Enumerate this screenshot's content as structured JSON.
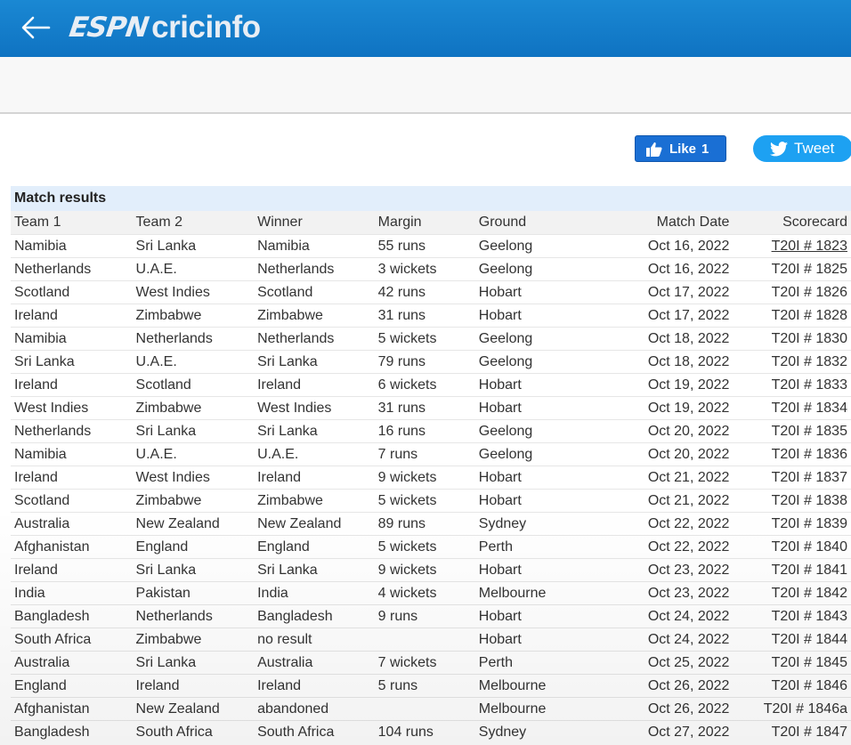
{
  "header": {
    "back_icon": "arrow-left-icon",
    "logo_espn": "ESPN",
    "logo_cricinfo": "cricinfo",
    "bg_color": "#1480cb"
  },
  "social": {
    "like_label": "Like",
    "like_count": "1",
    "tweet_label": "Tweet",
    "like_icon": "thumbs-up-icon",
    "tweet_icon": "twitter-bird-icon"
  },
  "table": {
    "title": "Match results",
    "headers": [
      "Team 1",
      "Team 2",
      "Winner",
      "Margin",
      "Ground",
      "Match Date",
      "Scorecard"
    ],
    "rows": [
      [
        "Namibia",
        "Sri Lanka",
        "Namibia",
        "55 runs",
        "Geelong",
        "Oct 16, 2022",
        "T20I # 1823"
      ],
      [
        "Netherlands",
        "U.A.E.",
        "Netherlands",
        "3 wickets",
        "Geelong",
        "Oct 16, 2022",
        "T20I # 1825"
      ],
      [
        "Scotland",
        "West Indies",
        "Scotland",
        "42 runs",
        "Hobart",
        "Oct 17, 2022",
        "T20I # 1826"
      ],
      [
        "Ireland",
        "Zimbabwe",
        "Zimbabwe",
        "31 runs",
        "Hobart",
        "Oct 17, 2022",
        "T20I # 1828"
      ],
      [
        "Namibia",
        "Netherlands",
        "Netherlands",
        "5 wickets",
        "Geelong",
        "Oct 18, 2022",
        "T20I # 1830"
      ],
      [
        "Sri Lanka",
        "U.A.E.",
        "Sri Lanka",
        "79 runs",
        "Geelong",
        "Oct 18, 2022",
        "T20I # 1832"
      ],
      [
        "Ireland",
        "Scotland",
        "Ireland",
        "6 wickets",
        "Hobart",
        "Oct 19, 2022",
        "T20I # 1833"
      ],
      [
        "West Indies",
        "Zimbabwe",
        "West Indies",
        "31 runs",
        "Hobart",
        "Oct 19, 2022",
        "T20I # 1834"
      ],
      [
        "Netherlands",
        "Sri Lanka",
        "Sri Lanka",
        "16 runs",
        "Geelong",
        "Oct 20, 2022",
        "T20I # 1835"
      ],
      [
        "Namibia",
        "U.A.E.",
        "U.A.E.",
        "7 runs",
        "Geelong",
        "Oct 20, 2022",
        "T20I # 1836"
      ],
      [
        "Ireland",
        "West Indies",
        "Ireland",
        "9 wickets",
        "Hobart",
        "Oct 21, 2022",
        "T20I # 1837"
      ],
      [
        "Scotland",
        "Zimbabwe",
        "Zimbabwe",
        "5 wickets",
        "Hobart",
        "Oct 21, 2022",
        "T20I # 1838"
      ],
      [
        "Australia",
        "New Zealand",
        "New Zealand",
        "89 runs",
        "Sydney",
        "Oct 22, 2022",
        "T20I # 1839"
      ],
      [
        "Afghanistan",
        "England",
        "England",
        "5 wickets",
        "Perth",
        "Oct 22, 2022",
        "T20I # 1840"
      ],
      [
        "Ireland",
        "Sri Lanka",
        "Sri Lanka",
        "9 wickets",
        "Hobart",
        "Oct 23, 2022",
        "T20I # 1841"
      ],
      [
        "India",
        "Pakistan",
        "India",
        "4 wickets",
        "Melbourne",
        "Oct 23, 2022",
        "T20I # 1842"
      ],
      [
        "Bangladesh",
        "Netherlands",
        "Bangladesh",
        "9 runs",
        "Hobart",
        "Oct 24, 2022",
        "T20I # 1843"
      ],
      [
        "South Africa",
        "Zimbabwe",
        "no result",
        "",
        "Hobart",
        "Oct 24, 2022",
        "T20I # 1844"
      ],
      [
        "Australia",
        "Sri Lanka",
        "Australia",
        "7 wickets",
        "Perth",
        "Oct 25, 2022",
        "T20I # 1845"
      ],
      [
        "England",
        "Ireland",
        "Ireland",
        "5 runs",
        "Melbourne",
        "Oct 26, 2022",
        "T20I # 1846"
      ],
      [
        "Afghanistan",
        "New Zealand",
        "abandoned",
        "",
        "Melbourne",
        "Oct 26, 2022",
        "T20I # 1846a"
      ],
      [
        "Bangladesh",
        "South Africa",
        "South Africa",
        "104 runs",
        "Sydney",
        "Oct 27, 2022",
        "T20I # 1847"
      ]
    ]
  }
}
